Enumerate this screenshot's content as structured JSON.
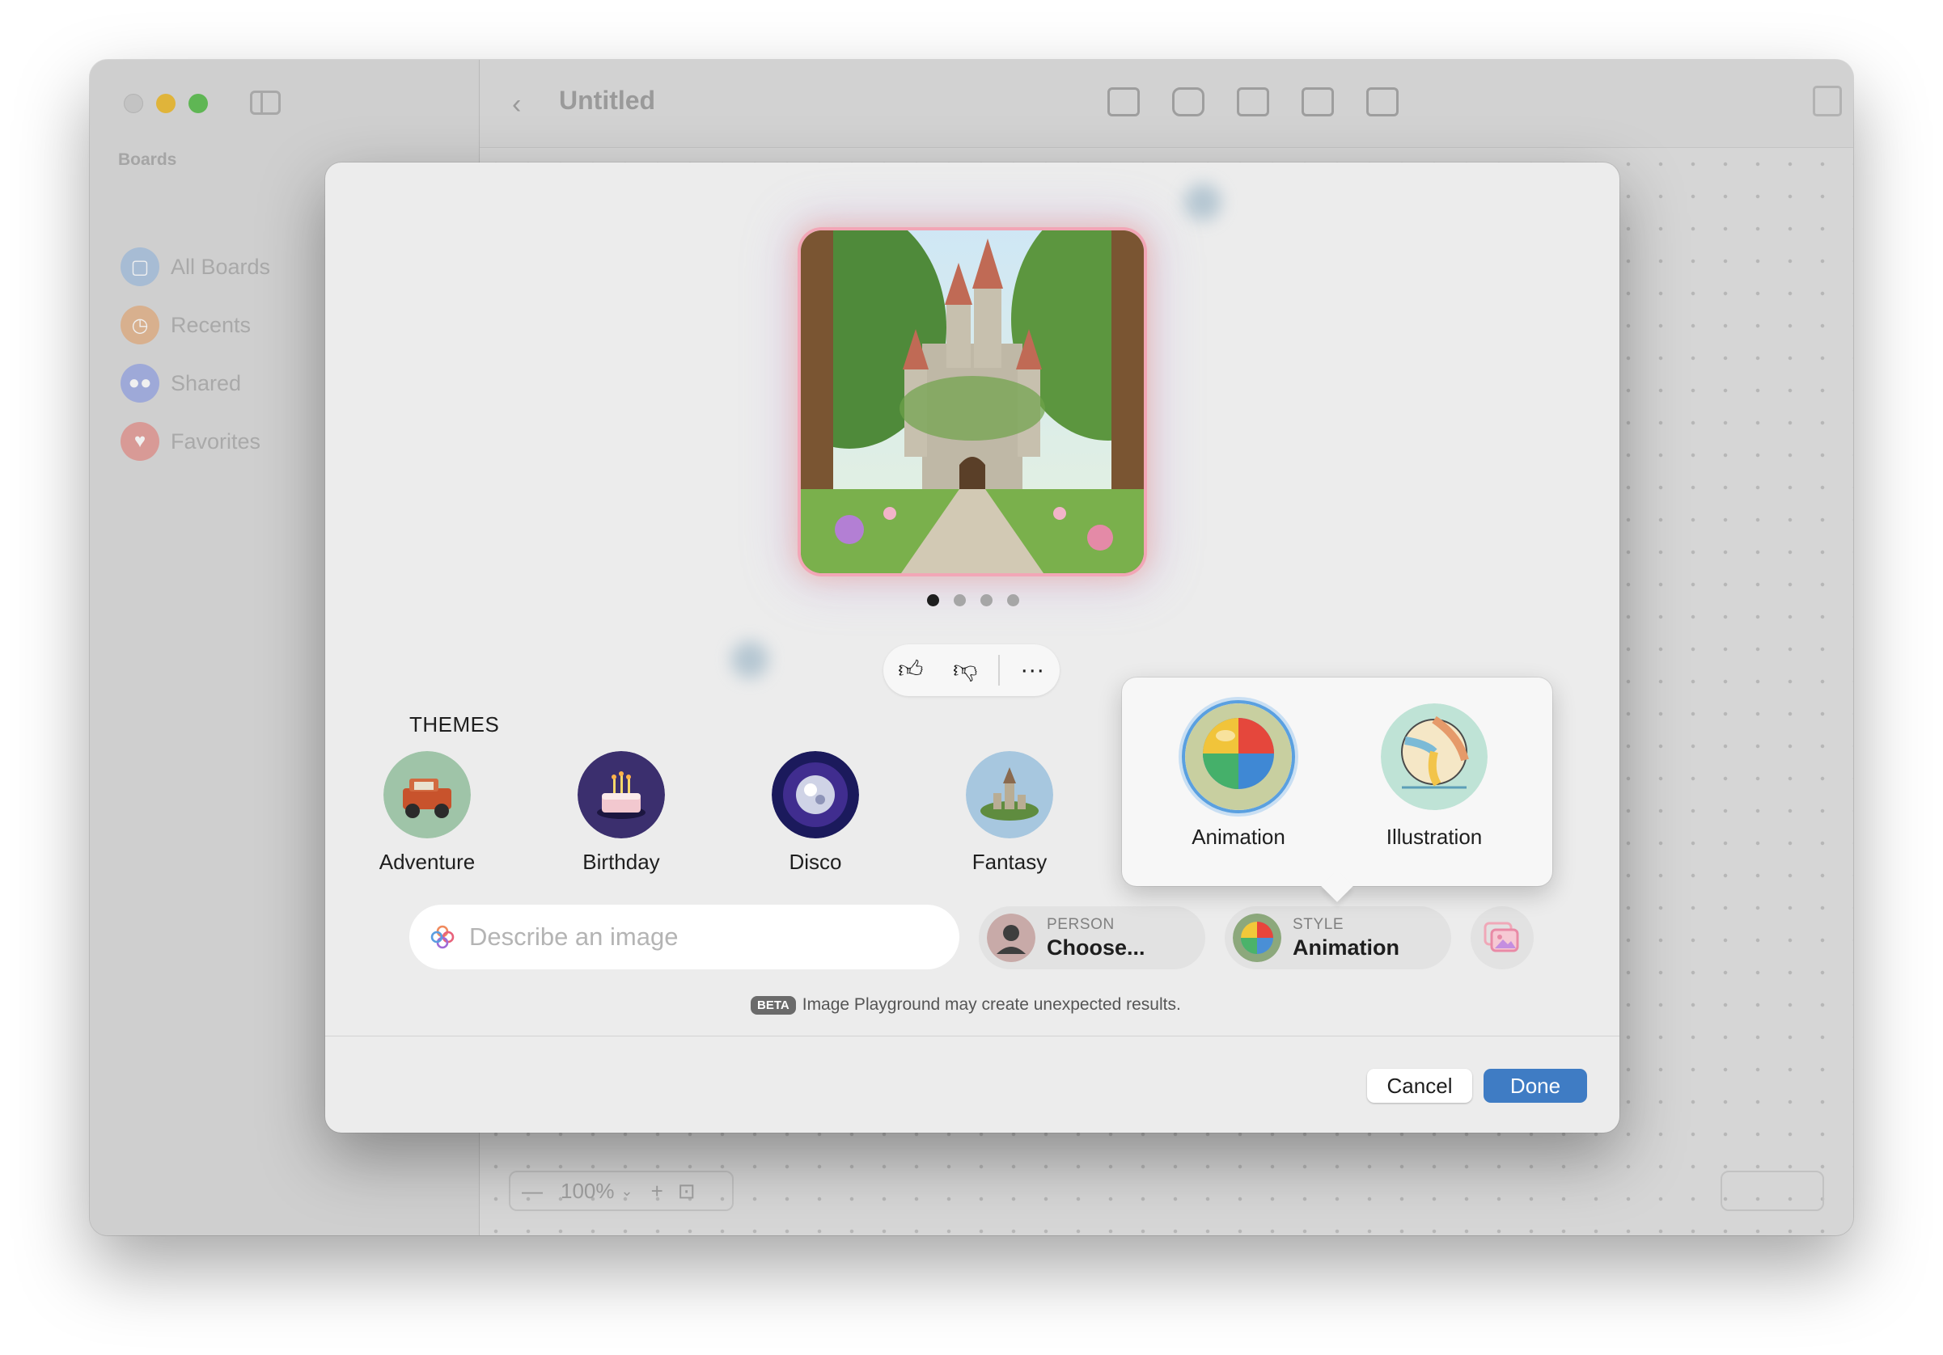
{
  "window": {
    "title": "Untitled",
    "sidebar": {
      "heading": "Boards",
      "items": [
        {
          "label": "All Boards",
          "icon": "all-boards-icon",
          "color": "#a7bcd4"
        },
        {
          "label": "Recents",
          "icon": "clock-icon",
          "color": "#d8b08e"
        },
        {
          "label": "Shared",
          "icon": "people-icon",
          "color": "#9ea9d8"
        },
        {
          "label": "Favorites",
          "icon": "heart-icon",
          "color": "#d89a96"
        }
      ]
    },
    "zoom": {
      "value": "100%"
    }
  },
  "modal": {
    "pager": {
      "count": 4,
      "active": 0
    },
    "themes": {
      "title": "THEMES",
      "items": [
        {
          "label": "Adventure",
          "icon": "jeep-icon"
        },
        {
          "label": "Birthday",
          "icon": "cake-icon"
        },
        {
          "label": "Disco",
          "icon": "disco-ball-icon"
        },
        {
          "label": "Fantasy",
          "icon": "castle-island-icon"
        }
      ]
    },
    "prompt": {
      "placeholder": "Describe an image",
      "value": ""
    },
    "person": {
      "caption": "PERSON",
      "value": "Choose..."
    },
    "style": {
      "caption": "STYLE",
      "value": "Animation"
    },
    "beta": {
      "badge": "BETA",
      "text": "Image Playground may create unexpected results."
    },
    "buttons": {
      "cancel": "Cancel",
      "done": "Done"
    },
    "accent_color": "#3f7cc4"
  },
  "style_popover": {
    "options": [
      {
        "label": "Animation",
        "selected": true,
        "icon": "beach-ball-3d-icon"
      },
      {
        "label": "Illustration",
        "selected": false,
        "icon": "beach-ball-drawn-icon"
      }
    ]
  }
}
